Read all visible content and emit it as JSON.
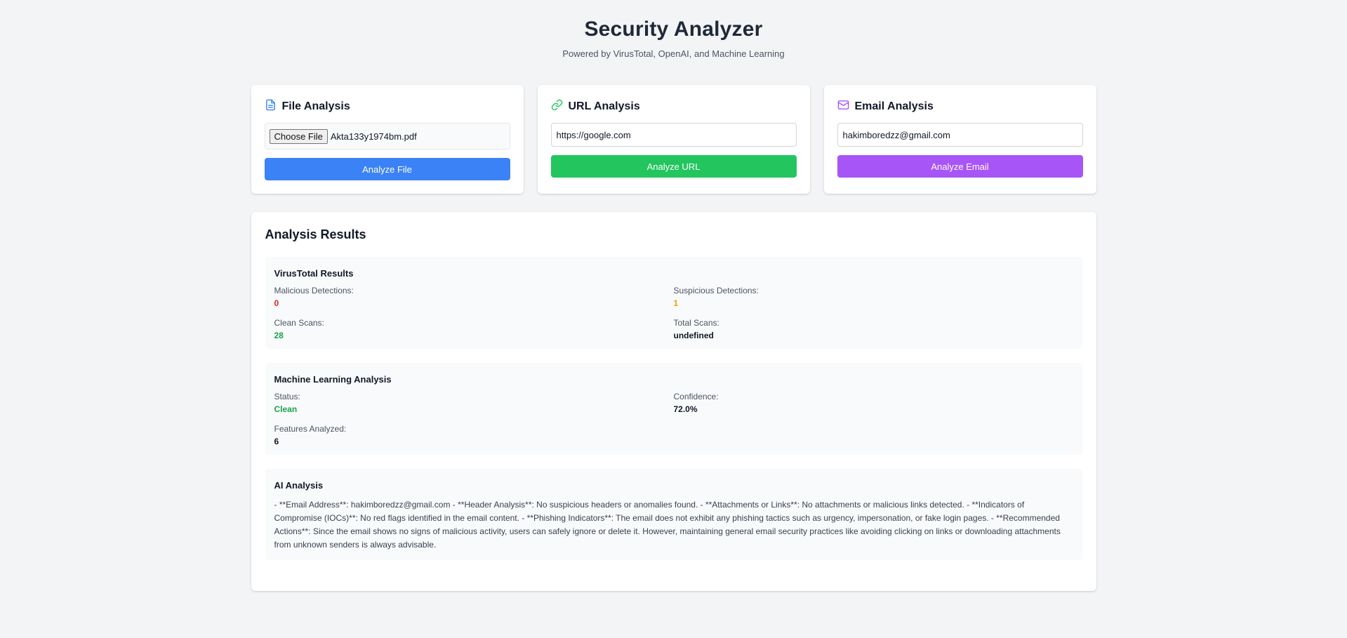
{
  "header": {
    "title": "Security Analyzer",
    "subtitle": "Powered by VirusTotal, OpenAI, and Machine Learning"
  },
  "file_card": {
    "title": "File Analysis",
    "icon": "file-icon",
    "choose_label": "Choose File",
    "file_name": "Akta133y1974bm.pdf",
    "button_label": "Analyze File",
    "accent": "#3b82f6"
  },
  "url_card": {
    "title": "URL Analysis",
    "icon": "link-icon",
    "input_value": "https://google.com",
    "button_label": "Analyze URL",
    "accent": "#22c55e"
  },
  "email_card": {
    "title": "Email Analysis",
    "icon": "mail-icon",
    "input_value": "hakimboredzz@gmail.com",
    "button_label": "Analyze Email",
    "accent": "#a855f7"
  },
  "results": {
    "title": "Analysis Results",
    "virustotal": {
      "title": "VirusTotal Results",
      "malicious_label": "Malicious Detections:",
      "malicious_value": "0",
      "suspicious_label": "Suspicious Detections:",
      "suspicious_value": "1",
      "clean_label": "Clean Scans:",
      "clean_value": "28",
      "total_label": "Total Scans:",
      "total_value": "undefined"
    },
    "ml": {
      "title": "Machine Learning Analysis",
      "status_label": "Status:",
      "status_value": "Clean",
      "confidence_label": "Confidence:",
      "confidence_value": "72.0%",
      "features_label": "Features Analyzed:",
      "features_value": "6"
    },
    "ai": {
      "title": "AI Analysis",
      "text": "- **Email Address**: hakimboredzz@gmail.com - **Header Analysis**: No suspicious headers or anomalies found. - **Attachments or Links**: No attachments or malicious links detected. - **Indicators of Compromise (IOCs)**: No red flags identified in the email content. - **Phishing Indicators**: The email does not exhibit any phishing tactics such as urgency, impersonation, or fake login pages. - **Recommended Actions**: Since the email shows no signs of malicious activity, users can safely ignore or delete it. However, maintaining general email security practices like avoiding clicking on links or downloading attachments from unknown senders is always advisable."
    }
  }
}
